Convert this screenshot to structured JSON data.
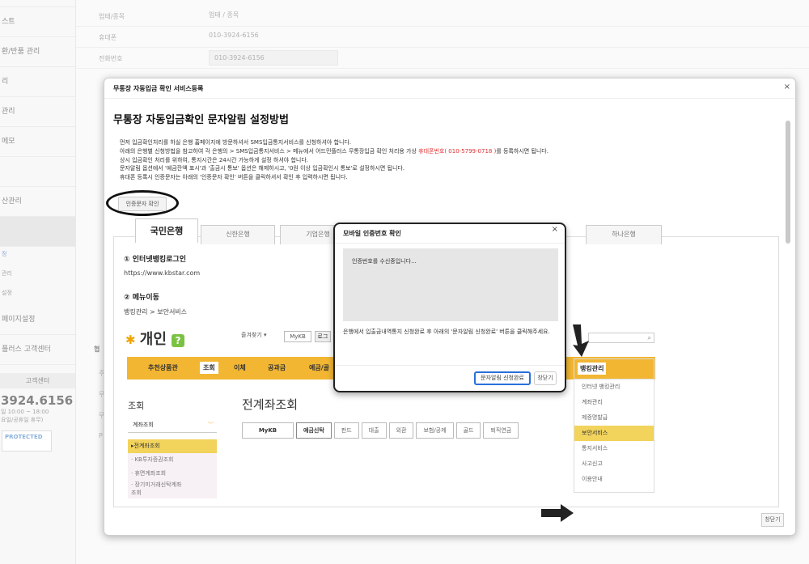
{
  "sidebar": {
    "items": [
      "",
      "스트",
      "환/반품 관리",
      "리",
      "관리",
      "메모",
      "",
      "산관리",
      ""
    ],
    "sub1": "정",
    "sub2": "관리",
    "sub3": "설정",
    "items2": [
      "페이지설정",
      "플러스 고객센터"
    ],
    "cc_title": "고객센터",
    "cc_phone": "3924.6156",
    "cc_hours": "일 10:00 ~ 18:00",
    "cc_note": "요일/공휴일 휴무)",
    "protected": "PROTECTED"
  },
  "background_form": {
    "rows": [
      {
        "label": "업태/종목",
        "value": "업태 / 종목"
      },
      {
        "label": "휴대폰",
        "value": "010-3924-6156"
      },
      {
        "label": "전화번호",
        "value": "010-3924-6156"
      }
    ],
    "side_labels": [
      "협",
      "주",
      "무",
      "무",
      "P"
    ]
  },
  "modal": {
    "header": "무통장 자동입금 확인 서비스등록",
    "close": "×",
    "title": "무통장 자동입금확인 문자알림 설정방법",
    "instructions": {
      "line1": "먼저 입금확인처리를 하실 은행 홈페이지에 방문하셔서 SMS입금통지서비스를 신청하셔야 합니다.",
      "line2_pre": "아래의 은행별 신청방법을 참고하여 각 은행의 > SMS입금통지서비스 > 메뉴에서 어드민플러스 무통장입금 확인 처리용 가상 ",
      "line2_red": "휴대폰번호( 010-5799-0718 )",
      "line2_post": "를 등록하시면 됩니다.",
      "line3": "상시 입금확인 처리를 위하여, 통지시간은 24시간 가능하게 설정 하셔야 합니다.",
      "line4": "문자알림 옵션에서 '예금잔액 표시'과 '출금시 통보' 옵션은 해제하시고, '0원 이상 입금확인시 통보'로 설정하시면 됩니다.",
      "line5": "휴대폰 등록시 인증문자는 아래의 '인증문자 확인' 버튼을 클릭하셔서 확인 후 입력하시면 됩니다."
    },
    "auth_button": "인증문자 확인",
    "bank_tabs": [
      "국민은행",
      "신한은행",
      "기업은행",
      "하나은행"
    ],
    "content": {
      "step1": "① 인터넷뱅킹로그인",
      "url": "https://www.kbstar.com",
      "step2": "② 메뉴이동",
      "path": "뱅킹관리 > 보안서비스"
    },
    "kb": {
      "logo": "개인",
      "q": "?",
      "fav": "즐겨찾기 ▾",
      "mykb": "MyKB",
      "login": "로그",
      "nav": [
        "추천상품관",
        "조회",
        "이체",
        "공과금",
        "예금/골"
      ],
      "search_icon": "⌕",
      "left_header": "조회",
      "select": "계좌조회",
      "left_list": [
        "▸전계좌조회",
        "· KB투자증권조회",
        "· 휴면계좌조회",
        "· 장기미거래신탁계좌",
        "조회"
      ],
      "main_header": "전계좌조회",
      "tabs": [
        "MyKB",
        "예금신탁",
        "펀드",
        "대출",
        "외환",
        "보험/공제",
        "골드",
        "퇴직연금"
      ],
      "mgmt_header": "뱅킹관리",
      "mgmt_list": [
        "인터넷 뱅킹관리",
        "계좌관리",
        "제증명발급",
        "보안서비스",
        "통지서비스",
        "사고신고",
        "이용안내"
      ]
    },
    "close_button": "창닫기"
  },
  "dialog": {
    "header": "모바일 인증번호 확인",
    "close": "×",
    "box_text": "인증번호를 수신중입니다...",
    "text": "은행에서 입출금내역통지 신청완료 후 아래의 '문자알림 신청완료' 버튼을 클릭해주세요.",
    "confirm_button": "문자알림 신청완료",
    "close_button": "창닫기"
  }
}
